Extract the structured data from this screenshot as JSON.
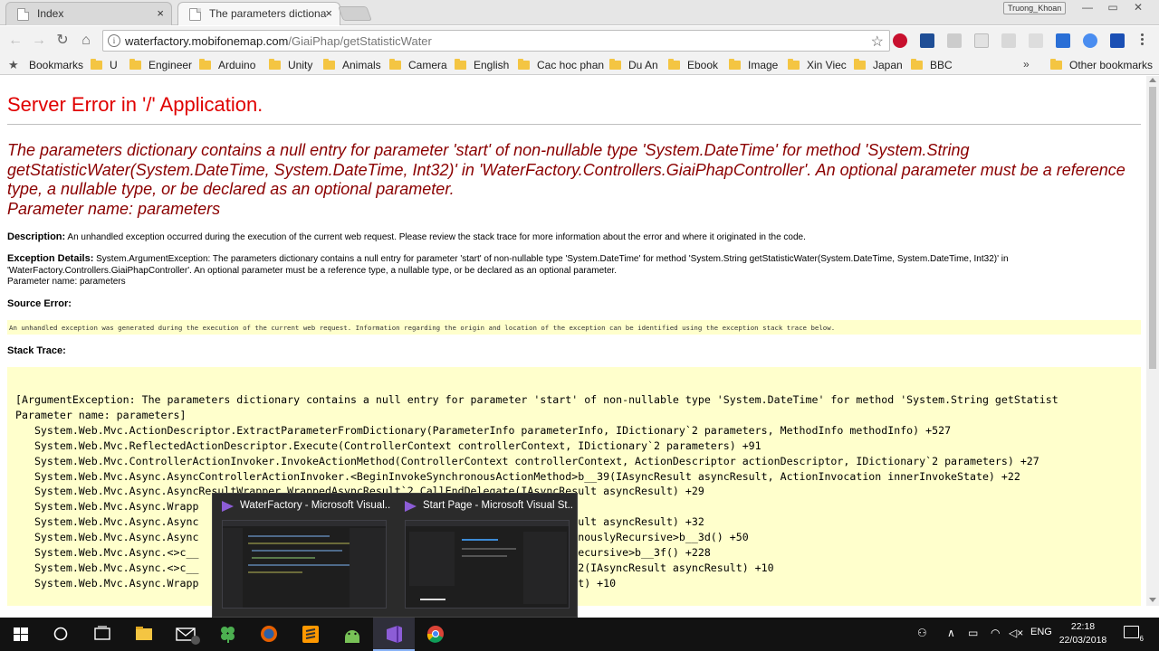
{
  "browser": {
    "tabs": [
      {
        "title": "Index",
        "active": false
      },
      {
        "title": "The parameters dictiona",
        "active": true
      }
    ],
    "profile_name": "Truong_Khoan",
    "url_host": "waterfactory.mobifonemap.com",
    "url_path": "/GiaiPhap/getStatisticWater",
    "bookmarks": [
      "Bookmarks",
      "U",
      "Engineer",
      "Arduino",
      "Unity",
      "Animals",
      "Camera",
      "English",
      "Cac hoc phan",
      "Du An",
      "Ebook",
      "Image",
      "Xin Viec",
      "Japan",
      "BBC"
    ],
    "other_bookmarks": "Other bookmarks"
  },
  "page": {
    "heading": "Server Error in '/' Application.",
    "message": "The parameters dictionary contains a null entry for parameter 'start' of non-nullable type 'System.DateTime' for method 'System.String getStatisticWater(System.DateTime, System.DateTime, Int32)' in 'WaterFactory.Controllers.GiaiPhapController'. An optional parameter must be a reference type, a nullable type, or be declared as an optional parameter.",
    "message_param": "Parameter name: parameters",
    "description_label": "Description:",
    "description_text": "An unhandled exception occurred during the execution of the current web request. Please review the stack trace for more information about the error and where it originated in the code.",
    "exception_label": "Exception Details:",
    "exception_text": "System.ArgumentException: The parameters dictionary contains a null entry for parameter 'start' of non-nullable type 'System.DateTime' for method 'System.String getStatisticWater(System.DateTime, System.DateTime, Int32)' in 'WaterFactory.Controllers.GiaiPhapController'. An optional parameter must be a reference type, a nullable type, or be declared as an optional parameter.",
    "exception_param": "Parameter name: parameters",
    "source_label": "Source Error:",
    "source_text": "An unhandled exception was generated during the execution of the current web request. Information regarding the origin and location of the exception can be identified using the exception stack trace below.",
    "stack_label": "Stack Trace:",
    "stack_lines": [
      "[ArgumentException: The parameters dictionary contains a null entry for parameter 'start' of non-nullable type 'System.DateTime' for method 'System.String getStatist",
      "Parameter name: parameters]",
      "   System.Web.Mvc.ActionDescriptor.ExtractParameterFromDictionary(ParameterInfo parameterInfo, IDictionary`2 parameters, MethodInfo methodInfo) +527",
      "   System.Web.Mvc.ReflectedActionDescriptor.Execute(ControllerContext controllerContext, IDictionary`2 parameters) +91",
      "   System.Web.Mvc.ControllerActionInvoker.InvokeActionMethod(ControllerContext controllerContext, ActionDescriptor actionDescriptor, IDictionary`2 parameters) +27",
      "   System.Web.Mvc.Async.AsyncControllerActionInvoker.<BeginInvokeSynchronousActionMethod>b__39(IAsyncResult asyncResult, ActionInvocation innerInvokeState) +22",
      "   System.Web.Mvc.Async.AsyncResultWrapper.WrappedAsyncResult`2.CallEndDelegate(IAsyncResult asyncResult) +29",
      "   System.Web.Mvc.Async.Wrapp",
      "   System.Web.Mvc.Async.Async                                                          esult asyncResult) +32",
      "   System.Web.Mvc.Async.Async                                                          ronouslyRecursive>b__3d() +50",
      "   System.Web.Mvc.Async.<>c__                                                          yRecursive>b__3f() +228",
      "   System.Web.Mvc.Async.<>c__                                                          _32(IAsyncResult asyncResult) +10",
      "   System.Web.Mvc.Async.Wrapp                                                          ult) +10"
    ]
  },
  "taskbar": {
    "previews": [
      "WaterFactory - Microsoft Visual...",
      "Start Page - Microsoft Visual St..."
    ],
    "language": "ENG",
    "time": "22:18",
    "date": "22/03/2018",
    "notification_count": "6"
  },
  "colors": {
    "error_heading": "#e00000",
    "error_message": "#8b0000",
    "code_background": "#ffffcc",
    "taskbar": "#121212"
  }
}
